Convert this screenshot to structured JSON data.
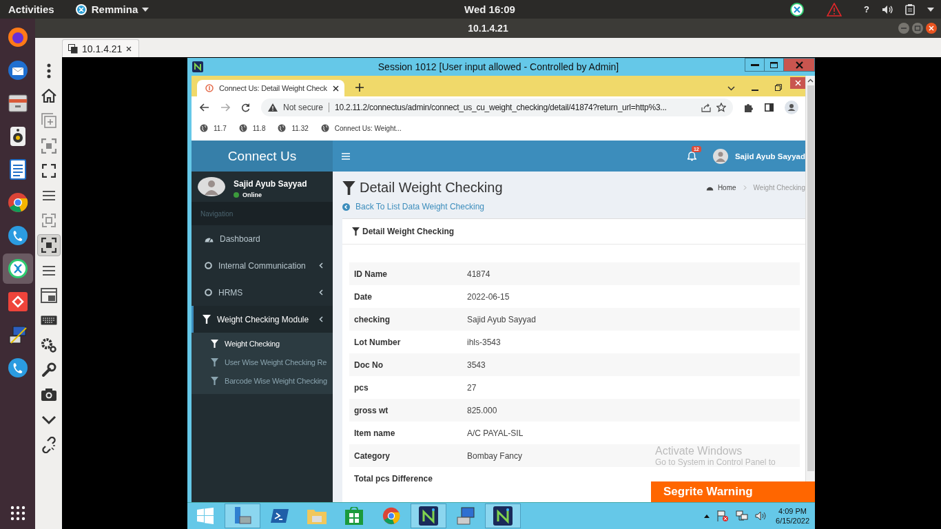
{
  "top_bar": {
    "activities": "Activities",
    "app_menu": "Remmina",
    "clock": "Wed 16:09",
    "help": "?"
  },
  "dock": [
    {
      "kind": "firefox",
      "selected": false
    },
    {
      "kind": "mail",
      "selected": false
    },
    {
      "kind": "files",
      "selected": false
    },
    {
      "kind": "speaker",
      "selected": false
    },
    {
      "kind": "writer",
      "selected": false
    },
    {
      "kind": "chrome",
      "selected": false
    },
    {
      "kind": "phone",
      "selected": false
    },
    {
      "kind": "remote",
      "selected": true
    },
    {
      "kind": "diamond",
      "selected": false
    },
    {
      "kind": "network",
      "selected": false
    },
    {
      "kind": "phone",
      "selected": false
    }
  ],
  "remmina": {
    "title": "10.1.4.21",
    "tab": "10.1.4.21",
    "toolbar": [
      {
        "kind": "dots",
        "selected": false
      },
      {
        "kind": "home",
        "selected": false
      },
      {
        "kind": "plus",
        "selected": false
      },
      {
        "kind": "fit",
        "selected": false
      },
      {
        "kind": "fullscreen",
        "selected": false
      },
      {
        "kind": "lines",
        "selected": false
      },
      {
        "kind": "scale",
        "selected": false
      },
      {
        "kind": "fit",
        "selected": true
      },
      {
        "kind": "lines",
        "selected": false
      },
      {
        "kind": "layout",
        "selected": false
      },
      {
        "kind": "keyboard",
        "selected": false
      },
      {
        "kind": "gears",
        "selected": false
      },
      {
        "kind": "wrench",
        "selected": false
      },
      {
        "kind": "camera",
        "selected": false
      },
      {
        "kind": "chevron",
        "selected": false
      },
      {
        "kind": "disconnect",
        "selected": false
      }
    ]
  },
  "session": {
    "title": "Session 1012 [User input allowed - Controlled by Admin]"
  },
  "browser": {
    "tab_title": "Connect Us: Detail Weight Check",
    "security": "Not secure",
    "url": "10.2.11.2/connectus/admin/connect_us_cu_weight_checking/detail/41874?return_url=http%3...",
    "bookmarks": [
      "11.7",
      "11.8",
      "11.32",
      "Connect Us: Weight..."
    ]
  },
  "app": {
    "brand": "Connect Us",
    "notification_count": "12",
    "user_name": "Sajid Ayub Sayyad"
  },
  "sidebar": {
    "user_name": "Sajid Ayub Sayyad",
    "status": "Online",
    "section": "Navigation",
    "items": [
      {
        "label": "Dashboard",
        "kind": "dashboard",
        "has_submenu": false,
        "selected": false
      },
      {
        "label": "Internal Communication",
        "kind": "circle",
        "has_submenu": true,
        "selected": false
      },
      {
        "label": "HRMS",
        "kind": "circle",
        "has_submenu": true,
        "selected": false
      },
      {
        "label": "Weight Checking Module",
        "kind": "filter",
        "has_submenu": true,
        "selected": true,
        "expanded": true,
        "children": [
          {
            "label": "Weight Checking",
            "selected": true
          },
          {
            "label": "User Wise Weight Checking Re",
            "selected": false
          },
          {
            "label": "Barcode Wise Weight Checking",
            "selected": false
          }
        ]
      }
    ]
  },
  "page": {
    "title": "Detail Weight Checking",
    "breadcrumb": [
      "Home",
      "Weight Checking"
    ],
    "back_link": "Back To List Data Weight Checking",
    "card_title": "Detail Weight Checking",
    "rows": [
      {
        "label": "ID Name",
        "value": "41874"
      },
      {
        "label": "Date",
        "value": "2022-06-15"
      },
      {
        "label": "checking",
        "value": "Sajid Ayub Sayyad"
      },
      {
        "label": "Lot Number",
        "value": "ihls-3543"
      },
      {
        "label": "Doc No",
        "value": "3543"
      },
      {
        "label": "pcs",
        "value": "27"
      },
      {
        "label": "gross wt",
        "value": "825.000"
      },
      {
        "label": "Item name",
        "value": "A/C PAYAL-SIL"
      },
      {
        "label": "Category",
        "value": "Bombay Fancy"
      },
      {
        "label": "Total pcs Difference"
      }
    ]
  },
  "overlay": {
    "activation_title": "Activate Windows",
    "activation_text": "Go to System in Control Panel to",
    "warning": "Segrite Warning"
  },
  "taskbar": {
    "apps": [
      {
        "kind": "server",
        "active": true
      },
      {
        "kind": "terminal",
        "active": false
      },
      {
        "kind": "folder",
        "active": false
      },
      {
        "kind": "store",
        "active": false
      },
      {
        "kind": "chrome",
        "active": false
      },
      {
        "kind": "nomachine",
        "active": true
      },
      {
        "kind": "computer",
        "active": false
      },
      {
        "kind": "nomachine",
        "active": true
      }
    ],
    "time": "4:09 PM",
    "date": "6/15/2022"
  }
}
